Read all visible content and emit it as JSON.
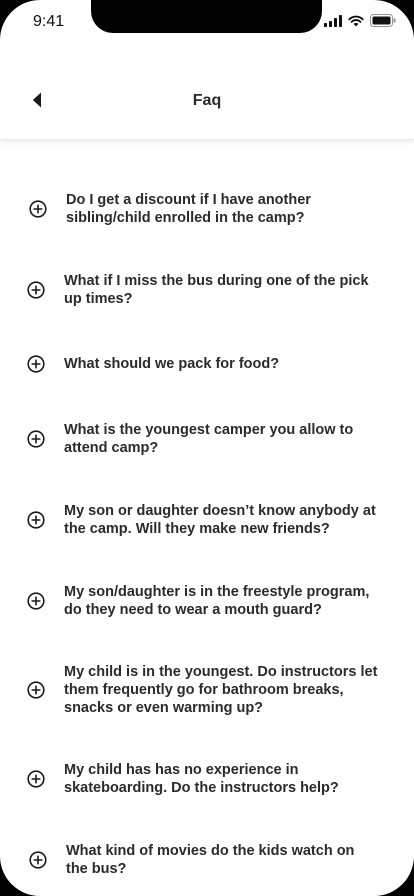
{
  "status_bar": {
    "time": "9:41"
  },
  "header": {
    "title": "Faq"
  },
  "faq": [
    {
      "question": "Do I get a discount if I have another sibling/child enrolled in the camp?"
    },
    {
      "question": "What if I miss the bus during one of the pick up times?"
    },
    {
      "question": "What should we pack for food?"
    },
    {
      "question": "What is the youngest camper you allow to attend camp?"
    },
    {
      "question": "My son or daughter doesn’t know anybody at the camp. Will they make new friends?"
    },
    {
      "question": "My son/daughter is in the freestyle program, do they need to wear a mouth guard?"
    },
    {
      "question": "My child is in the youngest. Do instructors let them frequently go for bathroom breaks, snacks or even warming up?"
    },
    {
      "question": "My child has has no experience in skateboarding. Do the instructors help?"
    },
    {
      "question": "What kind of movies do the kids watch on the bus?"
    }
  ]
}
